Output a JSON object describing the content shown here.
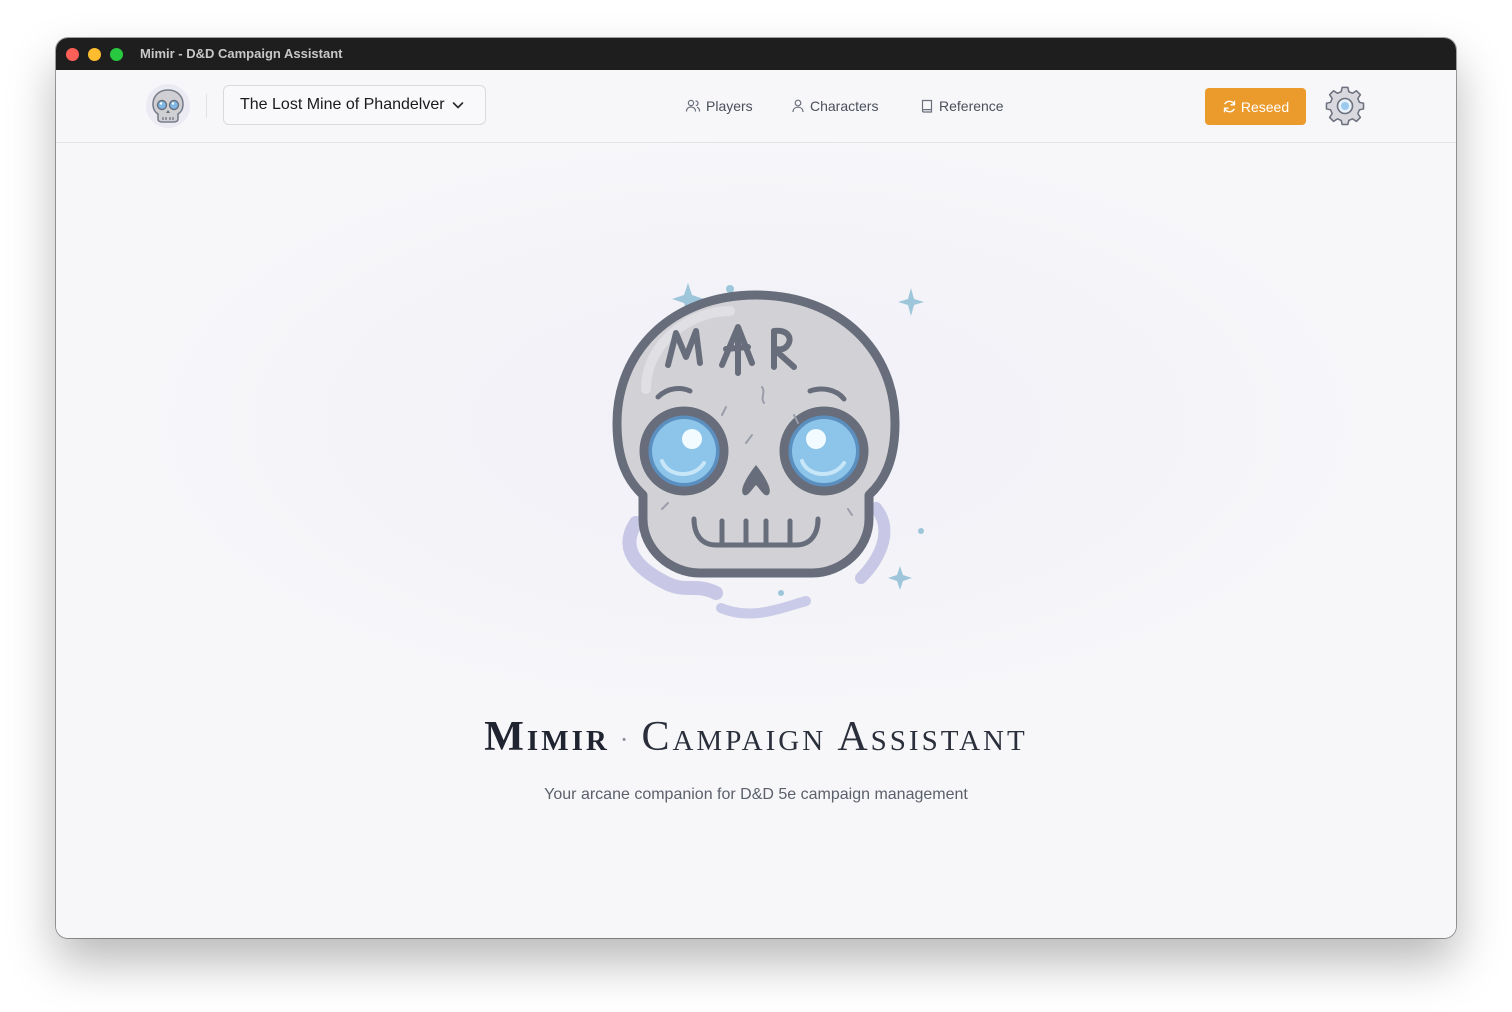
{
  "window": {
    "title": "Mimir - D&D Campaign Assistant"
  },
  "header": {
    "logo_icon": "skull-logo-icon",
    "campaign_select": {
      "selected": "The Lost Mine of Phandelver"
    },
    "nav": [
      {
        "label": "Players",
        "icon": "users-icon"
      },
      {
        "label": "Characters",
        "icon": "user-icon"
      },
      {
        "label": "Reference",
        "icon": "book-icon"
      }
    ],
    "reseed_label": "Reseed",
    "settings_icon": "gear-icon"
  },
  "main": {
    "title_bold": "Mimir",
    "title_light": "Campaign Assistant",
    "subtitle": "Your arcane companion for D&D 5e campaign management",
    "skull_runes": "MAR"
  },
  "colors": {
    "accent": "#eb9a2c",
    "titlebar": "#1e1e1e",
    "background": "#f7f7fa",
    "eye_blue": "#7fb8e6"
  }
}
